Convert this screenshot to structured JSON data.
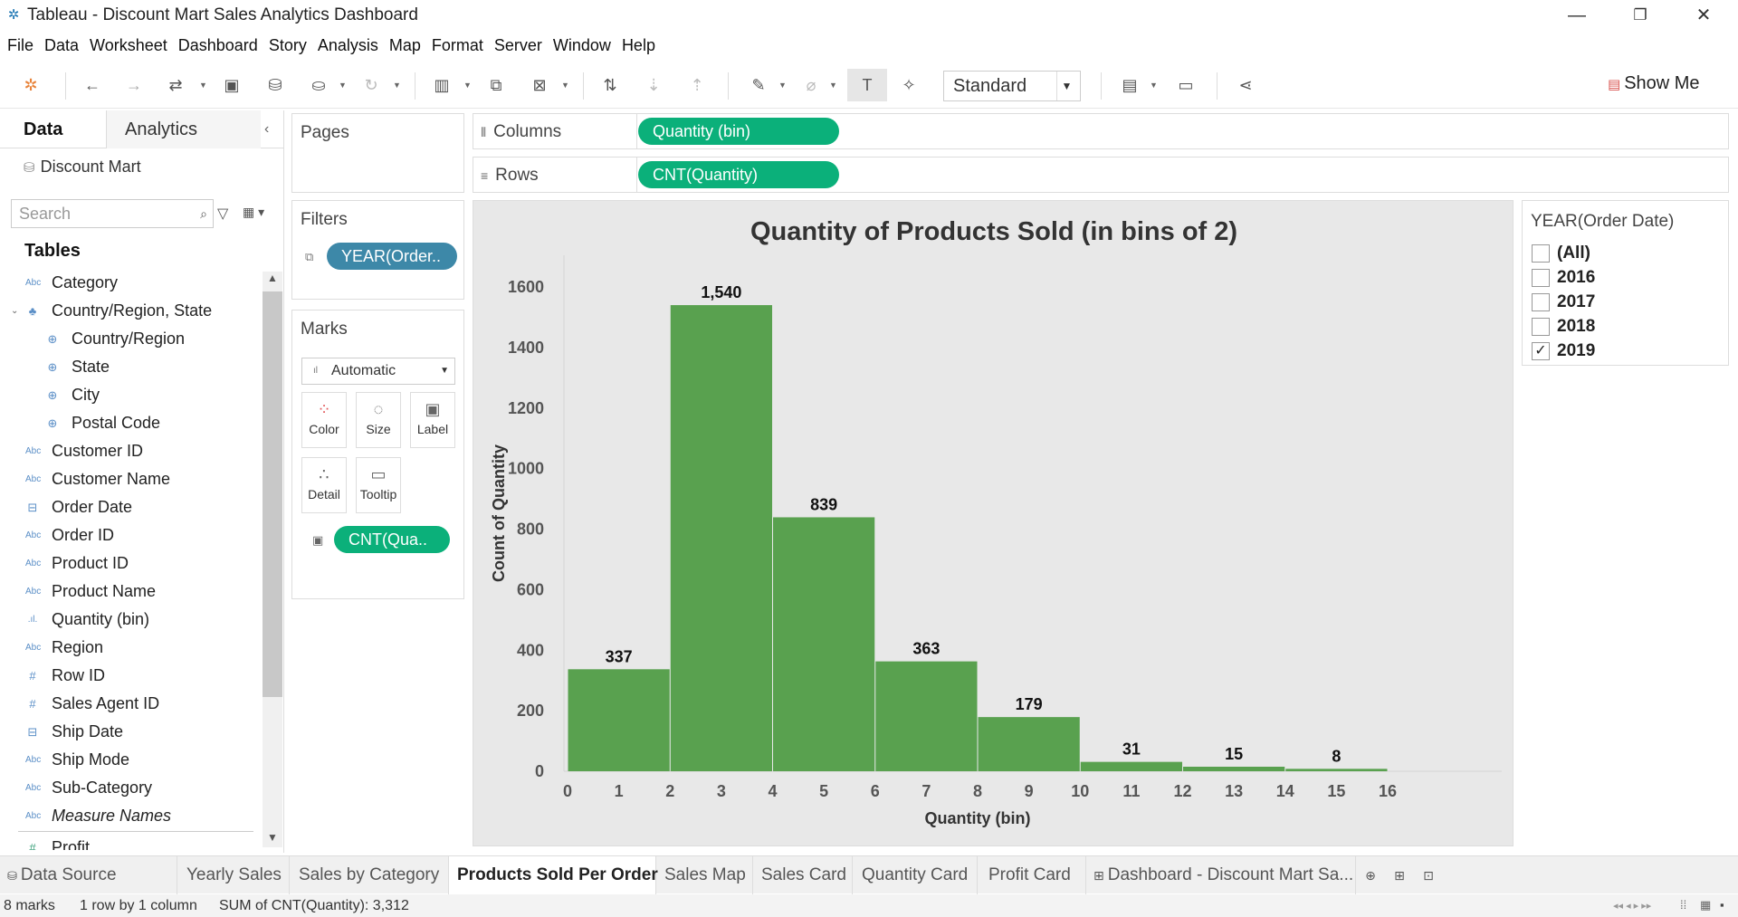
{
  "window": {
    "title": "Tableau - Discount Mart Sales Analytics Dashboard",
    "minimize_glyph": "—",
    "restore_glyph": "❐",
    "close_glyph": "✕"
  },
  "menu": [
    "File",
    "Data",
    "Worksheet",
    "Dashboard",
    "Story",
    "Analysis",
    "Map",
    "Format",
    "Server",
    "Window",
    "Help"
  ],
  "toolbar": {
    "fit_select": "Standard",
    "show_me": "Show Me"
  },
  "data_pane": {
    "tab_data": "Data",
    "tab_analytics": "Analytics",
    "datasource": "Discount Mart",
    "search_placeholder": "Search",
    "tables_heading": "Tables",
    "fields": [
      {
        "label": "Category",
        "type": "Abc"
      },
      {
        "label": "Country/Region, State",
        "type": "hier"
      },
      {
        "label": "Country/Region",
        "type": "geo"
      },
      {
        "label": "State",
        "type": "geo"
      },
      {
        "label": "City",
        "type": "geo"
      },
      {
        "label": "Postal Code",
        "type": "geo"
      },
      {
        "label": "Customer ID",
        "type": "Abc"
      },
      {
        "label": "Customer Name",
        "type": "Abc"
      },
      {
        "label": "Order Date",
        "type": "date"
      },
      {
        "label": "Order ID",
        "type": "Abc"
      },
      {
        "label": "Product ID",
        "type": "Abc"
      },
      {
        "label": "Product Name",
        "type": "Abc"
      },
      {
        "label": "Quantity (bin)",
        "type": "bin"
      },
      {
        "label": "Region",
        "type": "Abc"
      },
      {
        "label": "Row ID",
        "type": "num"
      },
      {
        "label": "Sales Agent ID",
        "type": "num"
      },
      {
        "label": "Ship Date",
        "type": "date"
      },
      {
        "label": "Ship Mode",
        "type": "Abc"
      },
      {
        "label": "Sub-Category",
        "type": "Abc"
      },
      {
        "label": "Measure Names",
        "type": "Abc"
      },
      {
        "label": "Profit",
        "type": "measure"
      }
    ]
  },
  "cards": {
    "pages": "Pages",
    "filters": "Filters",
    "filter_pill": "YEAR(Order..",
    "marks": "Marks",
    "marks_type": "Automatic",
    "mark_buttons": [
      "Color",
      "Size",
      "Label",
      "Detail",
      "Tooltip"
    ],
    "marks_pill": "CNT(Qua.."
  },
  "shelves": {
    "columns_label": "Columns",
    "columns_pill": "Quantity (bin)",
    "rows_label": "Rows",
    "rows_pill": "CNT(Quantity)"
  },
  "year_filter": {
    "title": "YEAR(Order Date)",
    "options": [
      {
        "label": "(All)",
        "checked": false
      },
      {
        "label": "2016",
        "checked": false
      },
      {
        "label": "2017",
        "checked": false
      },
      {
        "label": "2018",
        "checked": false
      },
      {
        "label": "2019",
        "checked": true
      }
    ]
  },
  "chart_data": {
    "type": "bar",
    "title": "Quantity of Products Sold (in bins of 2)",
    "xlabel": "Quantity (bin)",
    "ylabel": "Count of Quantity",
    "bins": [
      0,
      2,
      4,
      6,
      8,
      10,
      12,
      14
    ],
    "bin_width": 2,
    "values": [
      337,
      1540,
      839,
      363,
      179,
      31,
      15,
      8
    ],
    "value_labels": [
      "337",
      "1,540",
      "839",
      "363",
      "179",
      "31",
      "15",
      "8"
    ],
    "x_ticks": [
      "0",
      "1",
      "2",
      "3",
      "4",
      "5",
      "6",
      "7",
      "8",
      "9",
      "10",
      "11",
      "12",
      "13",
      "14",
      "15",
      "16"
    ],
    "y_ticks": [
      "0",
      "200",
      "400",
      "600",
      "800",
      "1000",
      "1200",
      "1400",
      "1600"
    ],
    "xlim": [
      0,
      16
    ],
    "ylim": [
      0,
      1650
    ],
    "bar_color": "#59a14f",
    "grid": false
  },
  "sheet_tabs": [
    {
      "label": "Data Source",
      "active": false
    },
    {
      "label": "Yearly Sales",
      "active": false
    },
    {
      "label": "Sales by Category",
      "active": false
    },
    {
      "label": "Products Sold Per Order",
      "active": true
    },
    {
      "label": "Sales Map",
      "active": false
    },
    {
      "label": "Sales Card",
      "active": false
    },
    {
      "label": "Quantity Card",
      "active": false
    },
    {
      "label": "Profit Card",
      "active": false
    },
    {
      "label": "Dashboard - Discount Mart Sa...",
      "active": false
    }
  ],
  "status": {
    "marks": "8 marks",
    "rows_cols": "1 row by 1 column",
    "sum": "SUM of CNT(Quantity): 3,312"
  },
  "colors": {
    "pill_green": "#0bb07a",
    "pill_blue": "#3d88a8",
    "bar": "#59a14f"
  }
}
